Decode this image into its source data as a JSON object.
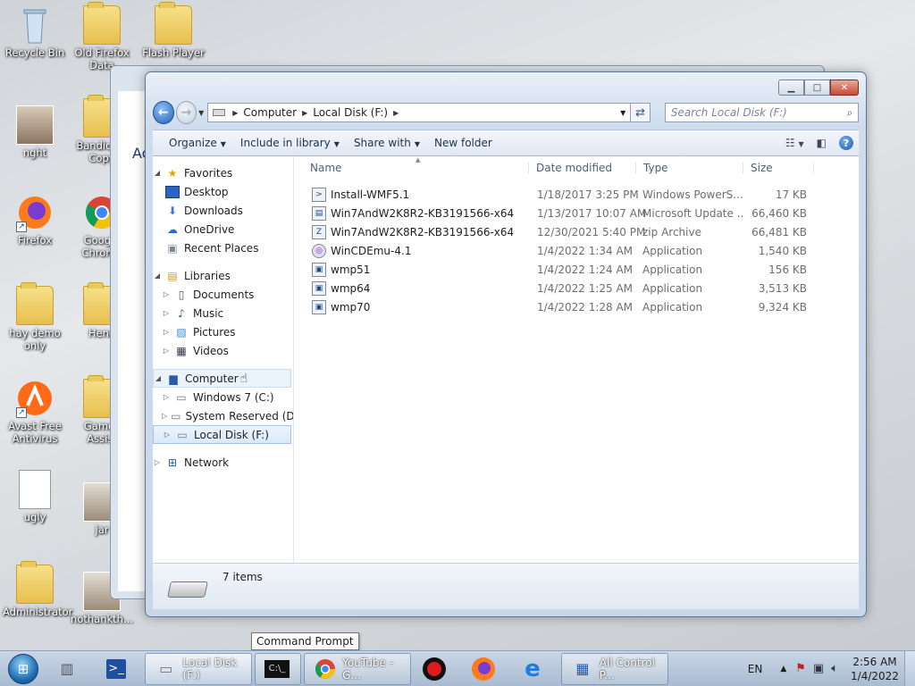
{
  "desktop": {
    "icons": [
      {
        "label": "Recycle Bin"
      },
      {
        "label": "Old Firefox Data"
      },
      {
        "label": "Flash Player"
      },
      {
        "label": "nght"
      },
      {
        "label": "Bandicam Copy"
      },
      {
        "label": "Firefox"
      },
      {
        "label": "Google Chrome"
      },
      {
        "label": "hay demo only"
      },
      {
        "label": "Hend"
      },
      {
        "label": "Avast Free Antivirus"
      },
      {
        "label": "Games Assist"
      },
      {
        "label": "ugly"
      },
      {
        "label": "jar"
      },
      {
        "label": "Administrator"
      },
      {
        "label": "nothankth..."
      }
    ]
  },
  "back_window": {
    "partial_text": "Ac"
  },
  "window": {
    "title": "Local Disk (F:)",
    "breadcrumb": [
      "Computer",
      "Local Disk (F:)"
    ],
    "search_placeholder": "Search Local Disk (F:)",
    "toolbar": {
      "organize": "Organize",
      "include_in_library": "Include in library",
      "share_with": "Share with",
      "new_folder": "New folder"
    },
    "nav": {
      "favorites": "Favorites",
      "desktop": "Desktop",
      "downloads": "Downloads",
      "onedrive": "OneDrive",
      "recent_places": "Recent Places",
      "libraries": "Libraries",
      "documents": "Documents",
      "music": "Music",
      "pictures": "Pictures",
      "videos": "Videos",
      "computer": "Computer",
      "windows7": "Windows 7 (C:)",
      "system_reserved": "System Reserved (D:",
      "local_disk_f": "Local Disk (F:)",
      "network": "Network"
    },
    "columns": {
      "name": "Name",
      "date": "Date modified",
      "type": "Type",
      "size": "Size"
    },
    "files": [
      {
        "name": "Install-WMF5.1",
        "date": "1/18/2017 3:25 PM",
        "type": "Windows PowerS...",
        "size": "17 KB",
        "icon": "powershell-script-icon"
      },
      {
        "name": "Win7AndW2K8R2-KB3191566-x64",
        "date": "1/13/2017 10:07 AM",
        "type": "Microsoft Update ...",
        "size": "66,460 KB",
        "icon": "update-package-icon"
      },
      {
        "name": "Win7AndW2K8R2-KB3191566-x64",
        "date": "12/30/2021 5:40 PM",
        "type": "zip Archive",
        "size": "66,481 KB",
        "icon": "zip-archive-icon"
      },
      {
        "name": "WinCDEmu-4.1",
        "date": "1/4/2022 1:34 AM",
        "type": "Application",
        "size": "1,540 KB",
        "icon": "wincdemu-app-icon"
      },
      {
        "name": "wmp51",
        "date": "1/4/2022 1:24 AM",
        "type": "Application",
        "size": "156 KB",
        "icon": "application-icon"
      },
      {
        "name": "wmp64",
        "date": "1/4/2022 1:25 AM",
        "type": "Application",
        "size": "3,513 KB",
        "icon": "application-icon"
      },
      {
        "name": "wmp70",
        "date": "1/4/2022 1:28 AM",
        "type": "Application",
        "size": "9,324 KB",
        "icon": "application-icon"
      }
    ],
    "status": "7 items"
  },
  "tooltip": "Command Prompt",
  "taskbar": {
    "tasks": [
      {
        "label": "Local Disk (F:)"
      },
      {
        "label": ""
      },
      {
        "label": "YouTube - G..."
      },
      {
        "label": ""
      },
      {
        "label": ""
      },
      {
        "label": ""
      },
      {
        "label": "All Control P..."
      }
    ],
    "lang": "EN",
    "time": "2:56 AM",
    "date": "1/4/2022"
  },
  "colors": {
    "accent": "#1f6fb8",
    "selection": "#d9e8fb"
  }
}
